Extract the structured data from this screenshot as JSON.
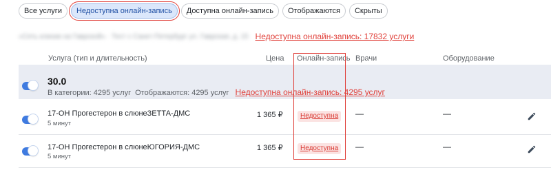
{
  "filters": {
    "all": "Все услуги",
    "unavailable": "Недоступна онлайн-запись",
    "available": "Доступна онлайн-запись",
    "shown": "Отображаются",
    "hidden": "Скрыты"
  },
  "org": {
    "address": "«Сеть клиник на Гаврской» · Тест с Санкт-Петербург ул. Гаврская, д. 15",
    "unavailable_link": "Недоступна онлайн-запись: 17832 услуги"
  },
  "columns": {
    "service": "Услуга (тип и длительность)",
    "price": "Цена",
    "online": "Онлайн-запись",
    "doctors": "Врачи",
    "equipment": "Оборудование"
  },
  "category": {
    "title": "30.0",
    "count_text": "В категории: 4295 услуг",
    "shown_text": "Отображаются: 4295 услуг",
    "unavailable_link": "Недоступна онлайн-запись: 4295 услуг",
    "enabled": true
  },
  "services": [
    {
      "name": "17-ОН Прогестерон в слюнеЗЕТТА-ДМС",
      "duration": "5 минут",
      "price": "1 365 ₽",
      "online_status": "Недоступна",
      "doctors": "—",
      "equipment": "—",
      "enabled": true
    },
    {
      "name": "17-ОН Прогестерон в слюнеЮГОРИЯ-ДМС",
      "duration": "5 минут",
      "price": "1 365 ₽",
      "online_status": "Недоступна",
      "doctors": "—",
      "equipment": "—",
      "enabled": true
    }
  ],
  "colors": {
    "accent": "#3f7be0",
    "danger": "#e0403a",
    "category_bg": "#e9ecf3"
  },
  "icons": {
    "edit": "pencil-icon"
  }
}
